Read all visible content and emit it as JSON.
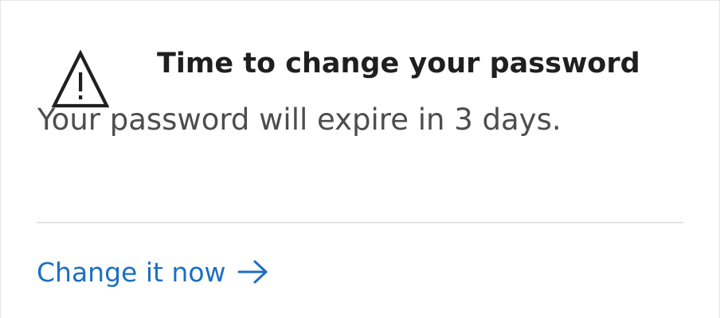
{
  "notification": {
    "title": "Time to change your password",
    "body": "Your password will expire in 3 days.",
    "action_label": "Change it now",
    "icon": "warning-triangle-icon",
    "arrow_icon": "arrow-right-icon"
  },
  "colors": {
    "title": "#1f1f1f",
    "body": "#4d4d4d",
    "link": "#1b6fc2",
    "divider": "#e3e3e3"
  }
}
